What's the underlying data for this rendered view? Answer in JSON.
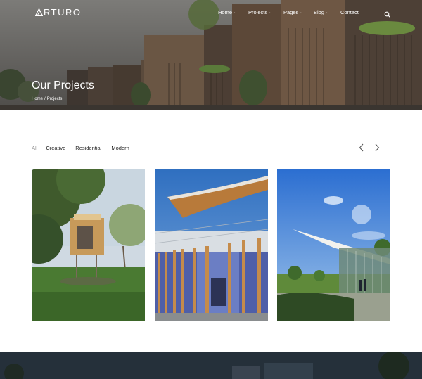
{
  "brand": {
    "name": "RTURO",
    "logo_icon": "a-triangle-logo"
  },
  "nav": {
    "items": [
      {
        "label": "Home",
        "has_dropdown": true
      },
      {
        "label": "Projects",
        "has_dropdown": true
      },
      {
        "label": "Pages",
        "has_dropdown": true
      },
      {
        "label": "Blog",
        "has_dropdown": true
      },
      {
        "label": "Contact",
        "has_dropdown": false
      }
    ],
    "search_icon": "search-icon"
  },
  "hero": {
    "title": "Our Projects",
    "breadcrumb": {
      "home": "Home",
      "separator": "/",
      "current": "Projects"
    }
  },
  "filters": {
    "items": [
      "All",
      "Creative",
      "Residential",
      "Modern"
    ],
    "active": "All"
  },
  "slider": {
    "prev_icon": "chevron-left-icon",
    "next_icon": "chevron-right-icon"
  },
  "projects": [
    {
      "image": "treehouse-in-forest"
    },
    {
      "image": "curved-roof-pavilion"
    },
    {
      "image": "glass-pavilion-sky"
    }
  ],
  "colors": {
    "accent_text": "#ffffff",
    "muted_filter": "#9a9a9a"
  }
}
